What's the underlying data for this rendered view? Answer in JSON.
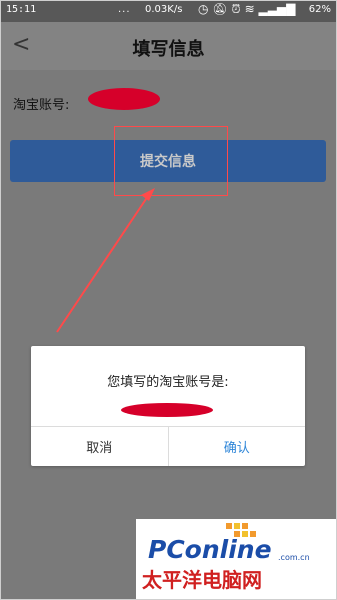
{
  "status_bar": {
    "time": "15:11",
    "dots": "...",
    "speed": "0.03K/s",
    "battery": "62%"
  },
  "header": {
    "back_icon": "chevron-left-icon",
    "title": "填写信息"
  },
  "form": {
    "account_label": "淘宝账号:",
    "submit_button": "提交信息"
  },
  "dialog": {
    "message": "您填写的淘宝账号是:",
    "cancel_label": "取消",
    "confirm_label": "确认"
  },
  "watermark": {
    "brand": "PConline",
    "domain": ".com.cn",
    "chinese": "太平洋电脑网"
  },
  "colors": {
    "submit_blue": "#2f5b99",
    "confirm_blue": "#2f86d8",
    "annotation_red": "#ff4a4a",
    "redaction_red": "#d6002a",
    "brand_blue": "#1b4da8",
    "brand_red": "#d02020"
  }
}
